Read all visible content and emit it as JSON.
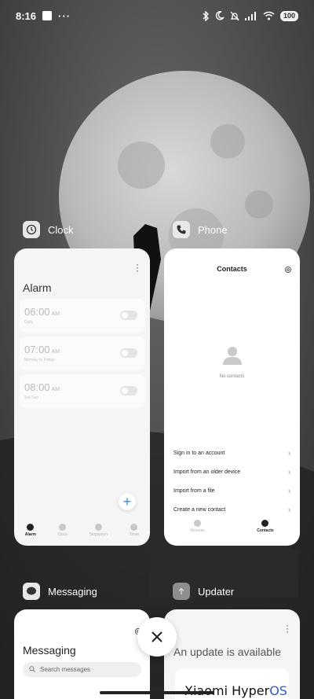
{
  "status_bar": {
    "time": "8:16",
    "dots": "···",
    "battery": "100"
  },
  "apps": {
    "clock": {
      "name": "Clock",
      "screen_title": "Alarm",
      "alarms": [
        {
          "time": "06:00",
          "ampm": "AM",
          "sub": "Daily"
        },
        {
          "time": "07:00",
          "ampm": "AM",
          "sub": "Monday to Friday"
        },
        {
          "time": "08:00",
          "ampm": "AM",
          "sub": "Sat-Sun"
        }
      ],
      "nav": [
        "Alarm",
        "Clock",
        "Stopwatch",
        "Timer"
      ]
    },
    "phone": {
      "name": "Phone",
      "screen_title": "Contacts",
      "empty_text": "No contacts",
      "menu": [
        "Sign in to an account",
        "Import from an older device",
        "Import from a file",
        "Create a new contact"
      ],
      "nav": [
        "Recents",
        "Contacts"
      ]
    },
    "messaging": {
      "name": "Messaging",
      "screen_title": "Messaging",
      "search_placeholder": "Search messages"
    },
    "updater": {
      "name": "Updater",
      "headline": "An update is available",
      "logo_word1": "Xiaomi Hyper",
      "logo_word2": "OS"
    }
  },
  "colors": {
    "accent": "#3a8ef6",
    "hyperos_blue": "#2a5bd7"
  }
}
